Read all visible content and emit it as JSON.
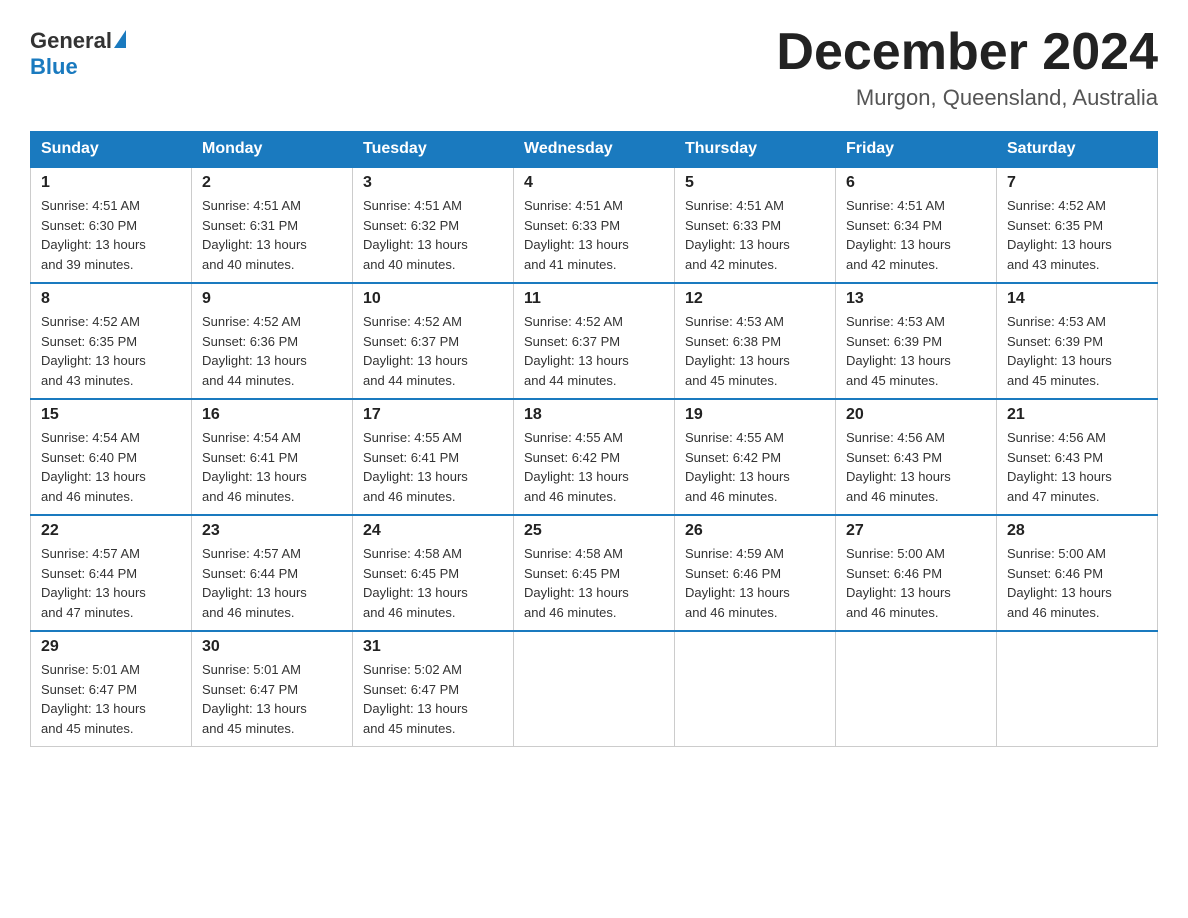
{
  "header": {
    "logo_general": "General",
    "logo_blue": "Blue",
    "title": "December 2024",
    "subtitle": "Murgon, Queensland, Australia"
  },
  "days_of_week": [
    "Sunday",
    "Monday",
    "Tuesday",
    "Wednesday",
    "Thursday",
    "Friday",
    "Saturday"
  ],
  "weeks": [
    [
      {
        "day": "1",
        "sunrise": "4:51 AM",
        "sunset": "6:30 PM",
        "daylight": "13 hours and 39 minutes."
      },
      {
        "day": "2",
        "sunrise": "4:51 AM",
        "sunset": "6:31 PM",
        "daylight": "13 hours and 40 minutes."
      },
      {
        "day": "3",
        "sunrise": "4:51 AM",
        "sunset": "6:32 PM",
        "daylight": "13 hours and 40 minutes."
      },
      {
        "day": "4",
        "sunrise": "4:51 AM",
        "sunset": "6:33 PM",
        "daylight": "13 hours and 41 minutes."
      },
      {
        "day": "5",
        "sunrise": "4:51 AM",
        "sunset": "6:33 PM",
        "daylight": "13 hours and 42 minutes."
      },
      {
        "day": "6",
        "sunrise": "4:51 AM",
        "sunset": "6:34 PM",
        "daylight": "13 hours and 42 minutes."
      },
      {
        "day": "7",
        "sunrise": "4:52 AM",
        "sunset": "6:35 PM",
        "daylight": "13 hours and 43 minutes."
      }
    ],
    [
      {
        "day": "8",
        "sunrise": "4:52 AM",
        "sunset": "6:35 PM",
        "daylight": "13 hours and 43 minutes."
      },
      {
        "day": "9",
        "sunrise": "4:52 AM",
        "sunset": "6:36 PM",
        "daylight": "13 hours and 44 minutes."
      },
      {
        "day": "10",
        "sunrise": "4:52 AM",
        "sunset": "6:37 PM",
        "daylight": "13 hours and 44 minutes."
      },
      {
        "day": "11",
        "sunrise": "4:52 AM",
        "sunset": "6:37 PM",
        "daylight": "13 hours and 44 minutes."
      },
      {
        "day": "12",
        "sunrise": "4:53 AM",
        "sunset": "6:38 PM",
        "daylight": "13 hours and 45 minutes."
      },
      {
        "day": "13",
        "sunrise": "4:53 AM",
        "sunset": "6:39 PM",
        "daylight": "13 hours and 45 minutes."
      },
      {
        "day": "14",
        "sunrise": "4:53 AM",
        "sunset": "6:39 PM",
        "daylight": "13 hours and 45 minutes."
      }
    ],
    [
      {
        "day": "15",
        "sunrise": "4:54 AM",
        "sunset": "6:40 PM",
        "daylight": "13 hours and 46 minutes."
      },
      {
        "day": "16",
        "sunrise": "4:54 AM",
        "sunset": "6:41 PM",
        "daylight": "13 hours and 46 minutes."
      },
      {
        "day": "17",
        "sunrise": "4:55 AM",
        "sunset": "6:41 PM",
        "daylight": "13 hours and 46 minutes."
      },
      {
        "day": "18",
        "sunrise": "4:55 AM",
        "sunset": "6:42 PM",
        "daylight": "13 hours and 46 minutes."
      },
      {
        "day": "19",
        "sunrise": "4:55 AM",
        "sunset": "6:42 PM",
        "daylight": "13 hours and 46 minutes."
      },
      {
        "day": "20",
        "sunrise": "4:56 AM",
        "sunset": "6:43 PM",
        "daylight": "13 hours and 46 minutes."
      },
      {
        "day": "21",
        "sunrise": "4:56 AM",
        "sunset": "6:43 PM",
        "daylight": "13 hours and 47 minutes."
      }
    ],
    [
      {
        "day": "22",
        "sunrise": "4:57 AM",
        "sunset": "6:44 PM",
        "daylight": "13 hours and 47 minutes."
      },
      {
        "day": "23",
        "sunrise": "4:57 AM",
        "sunset": "6:44 PM",
        "daylight": "13 hours and 46 minutes."
      },
      {
        "day": "24",
        "sunrise": "4:58 AM",
        "sunset": "6:45 PM",
        "daylight": "13 hours and 46 minutes."
      },
      {
        "day": "25",
        "sunrise": "4:58 AM",
        "sunset": "6:45 PM",
        "daylight": "13 hours and 46 minutes."
      },
      {
        "day": "26",
        "sunrise": "4:59 AM",
        "sunset": "6:46 PM",
        "daylight": "13 hours and 46 minutes."
      },
      {
        "day": "27",
        "sunrise": "5:00 AM",
        "sunset": "6:46 PM",
        "daylight": "13 hours and 46 minutes."
      },
      {
        "day": "28",
        "sunrise": "5:00 AM",
        "sunset": "6:46 PM",
        "daylight": "13 hours and 46 minutes."
      }
    ],
    [
      {
        "day": "29",
        "sunrise": "5:01 AM",
        "sunset": "6:47 PM",
        "daylight": "13 hours and 45 minutes."
      },
      {
        "day": "30",
        "sunrise": "5:01 AM",
        "sunset": "6:47 PM",
        "daylight": "13 hours and 45 minutes."
      },
      {
        "day": "31",
        "sunrise": "5:02 AM",
        "sunset": "6:47 PM",
        "daylight": "13 hours and 45 minutes."
      },
      null,
      null,
      null,
      null
    ]
  ],
  "labels": {
    "sunrise": "Sunrise:",
    "sunset": "Sunset:",
    "daylight": "Daylight:"
  }
}
